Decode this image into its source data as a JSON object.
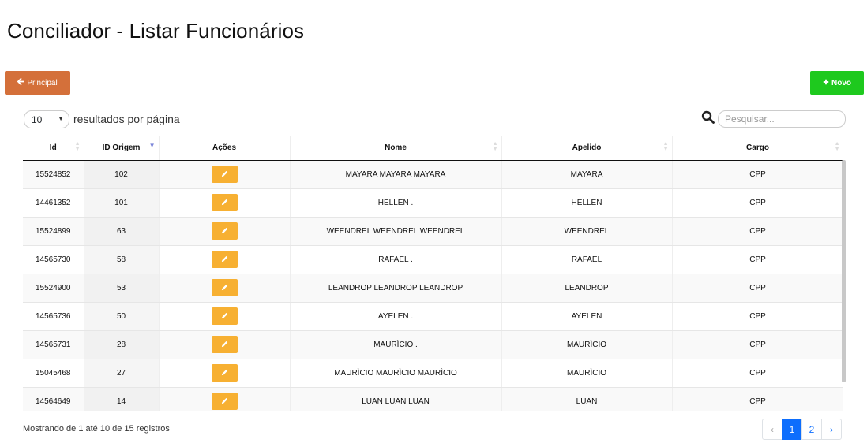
{
  "page": {
    "title": "Conciliador - Listar Funcionários"
  },
  "toolbar": {
    "principal_label": "Principal",
    "principal_icon": "arrow-left-icon",
    "principal_color": "#d4703a",
    "novo_label": "Novo",
    "novo_icon": "plus-icon",
    "novo_color": "#1ec91e"
  },
  "length": {
    "value": "10",
    "label": "resultados por página"
  },
  "search": {
    "placeholder": "Pesquisar..."
  },
  "table": {
    "columns": [
      "Id",
      "ID Origem",
      "Ações",
      "Nome",
      "Apelido",
      "Cargo"
    ],
    "sorted_column": "ID Origem",
    "sort_direction": "desc",
    "edit_icon": "pencil-icon",
    "edit_color": "#f7b032",
    "rows": [
      {
        "id": "15524852",
        "id_origem": "102",
        "nome": "MAYARA MAYARA MAYARA",
        "apelido": "MAYARA",
        "cargo": "CPP"
      },
      {
        "id": "14461352",
        "id_origem": "101",
        "nome": "HELLEN .",
        "apelido": "HELLEN",
        "cargo": "CPP"
      },
      {
        "id": "15524899",
        "id_origem": "63",
        "nome": "WEENDREL WEENDREL WEENDREL",
        "apelido": "WEENDREL",
        "cargo": "CPP"
      },
      {
        "id": "14565730",
        "id_origem": "58",
        "nome": "RAFAEL .",
        "apelido": "RAFAEL",
        "cargo": "CPP"
      },
      {
        "id": "15524900",
        "id_origem": "53",
        "nome": "LEANDROP LEANDROP LEANDROP",
        "apelido": "LEANDROP",
        "cargo": "CPP"
      },
      {
        "id": "14565736",
        "id_origem": "50",
        "nome": "AYELEN .",
        "apelido": "AYELEN",
        "cargo": "CPP"
      },
      {
        "id": "14565731",
        "id_origem": "28",
        "nome": "MAURÌCIO .",
        "apelido": "MAURÌCIO",
        "cargo": "CPP"
      },
      {
        "id": "15045468",
        "id_origem": "27",
        "nome": "MAURÌCIO MAURÌCIO MAURÌCIO",
        "apelido": "MAURÌCIO",
        "cargo": "CPP"
      },
      {
        "id": "14564649",
        "id_origem": "14",
        "nome": "LUAN LUAN LUAN",
        "apelido": "LUAN",
        "cargo": "CPP"
      }
    ]
  },
  "info": "Mostrando de 1 até 10 de 15 registros",
  "pagination": {
    "prev": "‹",
    "pages": [
      "1",
      "2"
    ],
    "current": "1",
    "next": "›",
    "active_color": "#0d6efd"
  }
}
